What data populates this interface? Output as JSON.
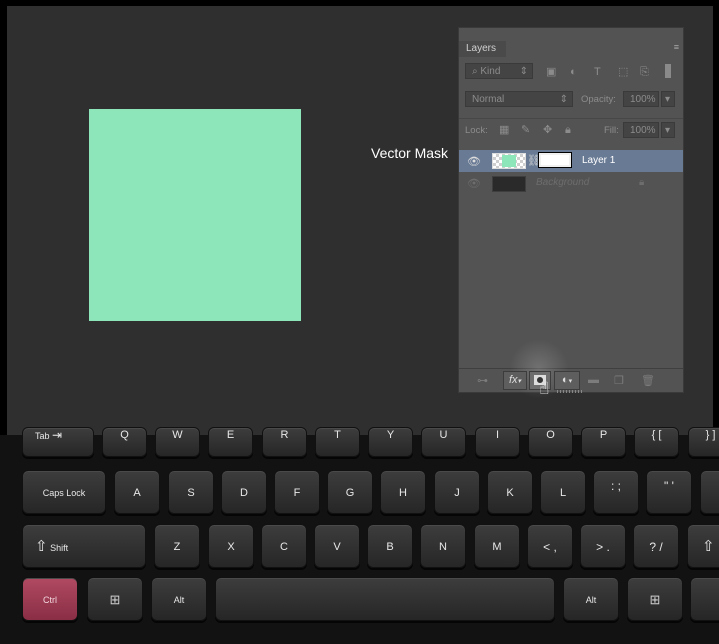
{
  "canvas": {
    "caption": "Vector Mask",
    "swatch_color": "#8ce6b9"
  },
  "layers_panel": {
    "tab_label": "Layers",
    "filter": {
      "label": "Kind",
      "icons": [
        "image-filter-icon",
        "adjustment-filter-icon",
        "type-filter-icon",
        "shape-filter-icon",
        "smart-object-filter-icon"
      ]
    },
    "blend_mode": "Normal",
    "opacity_label": "Opacity:",
    "opacity_value": "100%",
    "lock_label": "Lock:",
    "fill_label": "Fill:",
    "fill_value": "100%",
    "layers": [
      {
        "name": "Layer 1",
        "selected": true,
        "visible": true
      },
      {
        "name": "Background",
        "selected": false,
        "visible": false,
        "locked": true
      }
    ],
    "bottom_buttons": [
      "link-layers-icon",
      "fx-icon",
      "add-mask-icon",
      "adjustment-layer-icon",
      "folder-icon",
      "new-layer-icon",
      "trash-icon"
    ],
    "fx_label": "fx"
  },
  "keyboard": {
    "row1": [
      "Tab",
      "Q",
      "W",
      "E",
      "R",
      "T",
      "Y",
      "U",
      "I",
      "O",
      "P",
      "{ [",
      "} ]"
    ],
    "row2": [
      "Caps Lock",
      "A",
      "S",
      "D",
      "F",
      "G",
      "H",
      "J",
      "K",
      "L",
      ": ;",
      "\" '"
    ],
    "row3": [
      "Shift",
      "Z",
      "X",
      "C",
      "V",
      "B",
      "N",
      "M",
      "< ,",
      "> .",
      "? /"
    ],
    "row4": [
      "Ctrl",
      "Win",
      "Alt",
      "",
      "Alt",
      "Win"
    ],
    "active_key": "Ctrl",
    "active_color": "#a33d56"
  }
}
